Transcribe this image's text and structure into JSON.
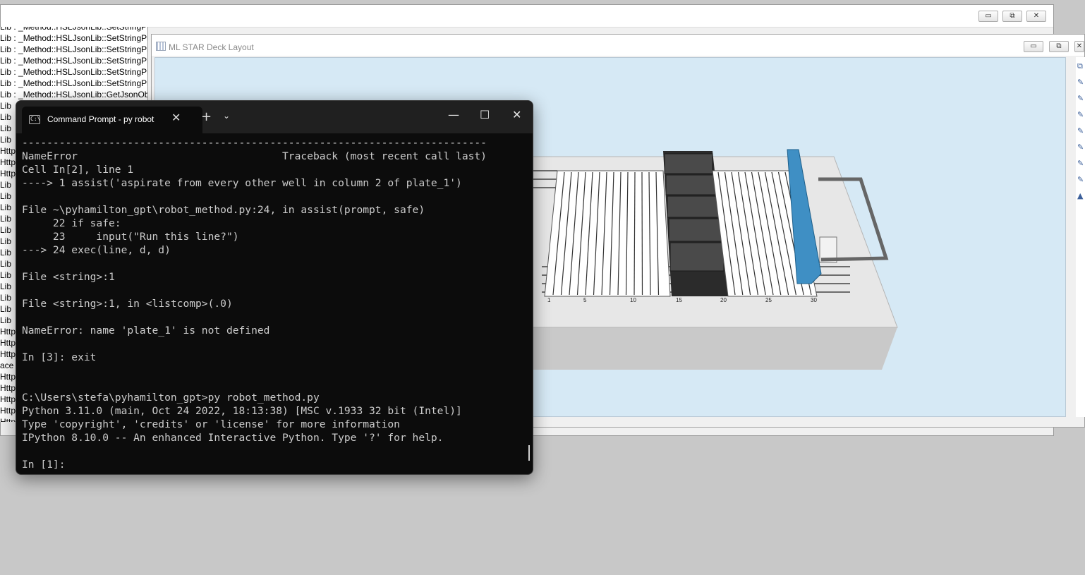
{
  "bg_window": {
    "controls": {
      "minimize": "▭",
      "maximize": "⧉",
      "close": "✕"
    }
  },
  "log_panel": {
    "lines": [
      "Lib : _Method::HSLJsonLib::SetStringProperty - start",
      "Lib : _Method::HSLJsonLib::SetStringProperty",
      "Lib : _Method::HSLJsonLib::SetStringProperty",
      "Lib : _Method::HSLJsonLib::SetStringProperty",
      "Lib : _Method::HSLJsonLib::SetStringProperty",
      "Lib : _Method::HSLJsonLib::SetStringProperty",
      "Lib : _Method::HSLJsonLib::GetJsonObject",
      "Lib",
      "Lib",
      "Lib",
      "Lib",
      "Http",
      "Http",
      "Http",
      "Lib",
      "Lib",
      "Lib",
      "Lib",
      "Lib",
      "Lib",
      "Lib",
      "Lib",
      "Lib",
      "Lib",
      "Lib",
      "Lib",
      "Lib",
      "Http",
      "Http",
      "Http",
      "ace",
      "Http",
      "Http",
      "Http",
      "Http",
      "Http",
      "Http"
    ]
  },
  "deck_window": {
    "title": "ML STAR Deck Layout",
    "controls": {
      "minimize": "▭",
      "maximize": "⧉",
      "close": "✕"
    },
    "track_labels": [
      "1",
      "5",
      "10",
      "15",
      "20",
      "25",
      "30"
    ],
    "toolbar_icons": [
      "⧉",
      "✎",
      "✎",
      "✎",
      "✎",
      "✎",
      "✎",
      "✎",
      "▲"
    ]
  },
  "terminal": {
    "tab_title": "Command Prompt - py  robot",
    "tab_close": "✕",
    "new_tab": "+",
    "dropdown": "⌄",
    "controls": {
      "minimize": "—",
      "maximize": "☐",
      "close": "✕"
    },
    "lines": [
      "---------------------------------------------------------------------------",
      "NameError                                 Traceback (most recent call last)",
      "Cell In[2], line 1",
      "----> 1 assist('aspirate from every other well in column 2 of plate_1')",
      "",
      "File ~\\pyhamilton_gpt\\robot_method.py:24, in assist(prompt, safe)",
      "     22 if safe:",
      "     23     input(\"Run this line?\")",
      "---> 24 exec(line, d, d)",
      "",
      "File <string>:1",
      "",
      "File <string>:1, in <listcomp>(.0)",
      "",
      "NameError: name 'plate_1' is not defined",
      "",
      "In [3]: exit",
      "",
      "",
      "C:\\Users\\stefa\\pyhamilton_gpt>py robot_method.py",
      "Python 3.11.0 (main, Oct 24 2022, 18:13:38) [MSC v.1933 32 bit (Intel)]",
      "Type 'copyright', 'credits' or 'license' for more information",
      "IPython 8.10.0 -- An enhanced Interactive Python. Type '?' for help.",
      "",
      "In [1]:"
    ]
  }
}
